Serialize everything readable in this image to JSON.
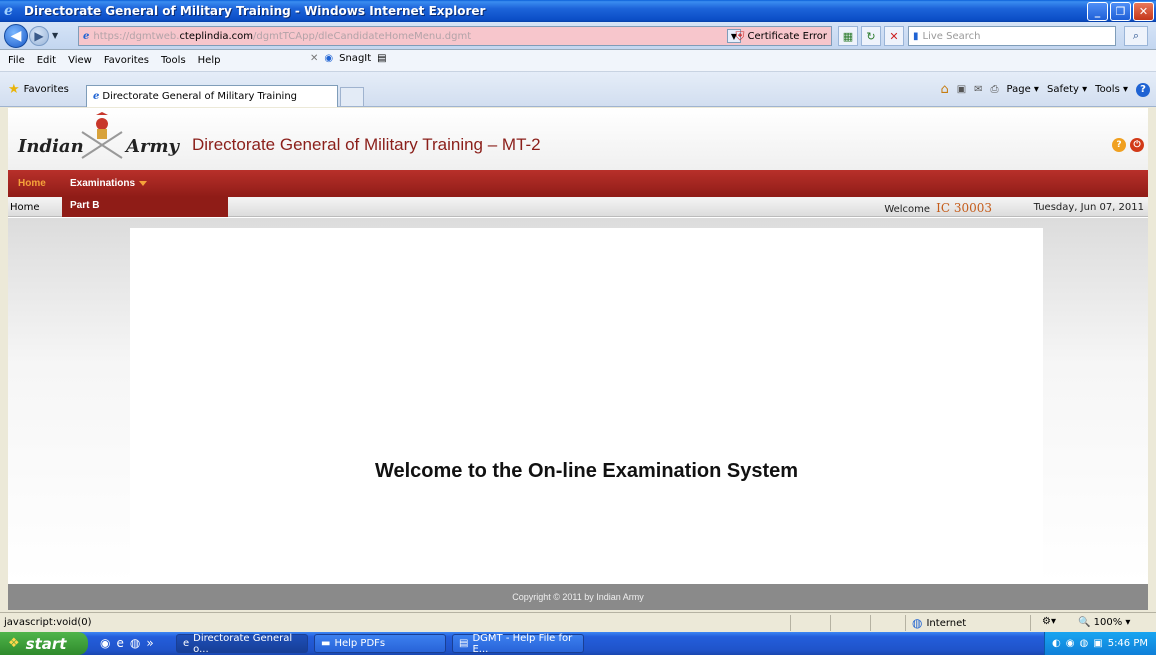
{
  "window": {
    "title": "Directorate General of Military Training - Windows Internet Explorer",
    "controls": [
      "minimize",
      "maximize",
      "close"
    ]
  },
  "address_bar": {
    "url_prefix": "https://dgmtweb.",
    "url_host": "cteplindia.com",
    "url_path": "/dgmtTCApp/dleCandidateHomeMenu.dgmt",
    "cert_error": "Certificate Error",
    "search_placeholder": "Live Search"
  },
  "menu_bar": {
    "items": [
      "File",
      "Edit",
      "View",
      "Favorites",
      "Tools",
      "Help"
    ],
    "snagit_label": "SnagIt"
  },
  "favorites_bar": {
    "favorites_label": "Favorites",
    "tab_title": "Directorate General of Military Training",
    "command_items": [
      "Page ▾",
      "Safety ▾",
      "Tools ▾"
    ]
  },
  "site": {
    "logo_left": "Indian",
    "logo_right": "Army",
    "title": "Directorate General of Military Training – MT-2",
    "nav": {
      "home": "Home",
      "examinations": "Examinations"
    },
    "breadcrumb": "Home",
    "dropdown_item": "Part B",
    "welcome_label": "Welcome",
    "user_id": "IC 30003",
    "date": "Tuesday, Jun 07, 2011",
    "welcome_message": "Welcome to the On-line Examination System",
    "footer": "Copyright © 2011 by Indian Army"
  },
  "status_bar": {
    "text": "javascript:void(0)",
    "zone": "Internet",
    "zoom": "100%"
  },
  "taskbar": {
    "start_label": "start",
    "items": [
      {
        "label": "Directorate General o...",
        "active": true
      },
      {
        "label": "Help PDFs",
        "active": false
      },
      {
        "label": "DGMT - Help File for E...",
        "active": false
      }
    ],
    "clock": "5:46 PM"
  },
  "colors": {
    "brand_red": "#8f1c17",
    "nav_orange": "#f5a23a",
    "title_red": "#8b1f1a",
    "user_orange": "#c55c1a"
  }
}
